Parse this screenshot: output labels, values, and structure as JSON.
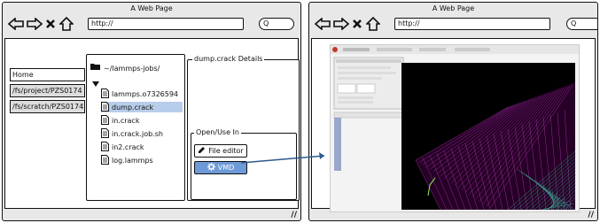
{
  "left_window": {
    "title": "A Web Page",
    "url": "http://",
    "search_placeholder": "Q",
    "sidebar_tabs": [
      {
        "label": "Home"
      },
      {
        "label": "/fs/project/PZS0174"
      },
      {
        "label": "/fs/scratch/PZS0174"
      }
    ],
    "file_tree": {
      "root": "~/lammps-jobs/",
      "files": [
        {
          "name": "lammps.o7326594",
          "selected": false
        },
        {
          "name": "dump.crack",
          "selected": true
        },
        {
          "name": "in.crack",
          "selected": false
        },
        {
          "name": "in.crack.job.sh",
          "selected": false
        },
        {
          "name": "in2.crack",
          "selected": false
        },
        {
          "name": "log.lammps",
          "selected": false
        }
      ]
    },
    "details_title": "dump.crack Details",
    "open_use_title": "Open/Use In",
    "file_editor_label": "File editor",
    "vmd_label": "VMD"
  },
  "right_window": {
    "title": "A Web Page",
    "url": "http://",
    "search_placeholder": "Q"
  },
  "colors": {
    "selection": "#b8cde9",
    "primary_button": "#6e9ad8",
    "connector_arrow": "#2c5a8e",
    "vmd_mesh": "#c040c0",
    "vmd_mesh_secondary": "#3ec8a8"
  }
}
